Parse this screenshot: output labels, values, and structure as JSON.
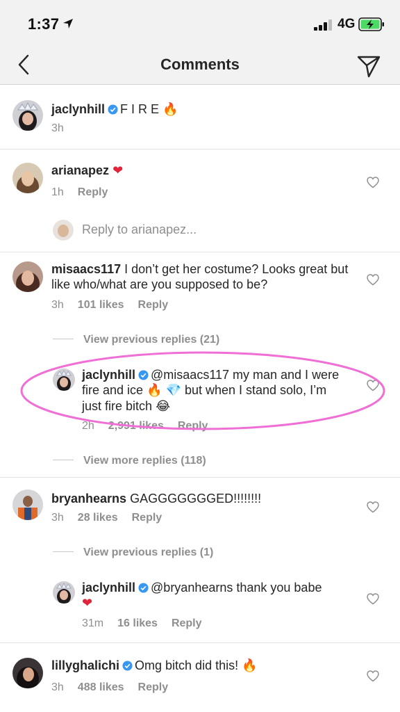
{
  "status": {
    "time": "1:37",
    "network": "4G"
  },
  "nav": {
    "title": "Comments"
  },
  "caption": {
    "username": "jaclynhill",
    "text": "F I R E",
    "emoji": "🔥",
    "time": "3h"
  },
  "comments": [
    {
      "username": "arianapez",
      "text": "",
      "emoji": "❤",
      "time": "1h",
      "reply": "Reply"
    },
    {
      "username": "misaacs117",
      "text": "I don’t get her costume? Looks great but like who/what are you supposed to be?",
      "time": "3h",
      "likes": "101 likes",
      "reply": "Reply",
      "view_previous": "View previous replies (21)",
      "view_more": "View more replies (118)",
      "sub_reply": {
        "username": "jaclynhill",
        "text_line1": "@misaacs117 my man and I were",
        "text_line2_a": "fire and ice",
        "text_line2_b": "but when I stand solo, I’m",
        "text_line3": "just fire bitch",
        "time": "2h",
        "likes": "2,991 likes",
        "reply": "Reply"
      }
    },
    {
      "username": "bryanhearns",
      "text": "GAGGGGGGGED!!!!!!!!",
      "time": "3h",
      "likes": "28 likes",
      "reply": "Reply",
      "view_previous": "View previous replies (1)",
      "sub_reply": {
        "username": "jaclynhill",
        "text": "@bryanhearns thank you babe",
        "emoji": "❤",
        "time": "31m",
        "likes": "16 likes",
        "reply": "Reply"
      }
    },
    {
      "username": "lillyghalichi",
      "text": "Omg bitch did this!",
      "emoji": "🔥",
      "time": "3h",
      "likes": "488 likes",
      "reply": "Reply"
    }
  ],
  "reply_input": {
    "placeholder": "Reply to arianapez..."
  },
  "colors": {
    "verified": "#3897f0",
    "heart_red": "#e0243a",
    "highlight": "#ef6fd6",
    "muted": "#8e8e8e"
  }
}
